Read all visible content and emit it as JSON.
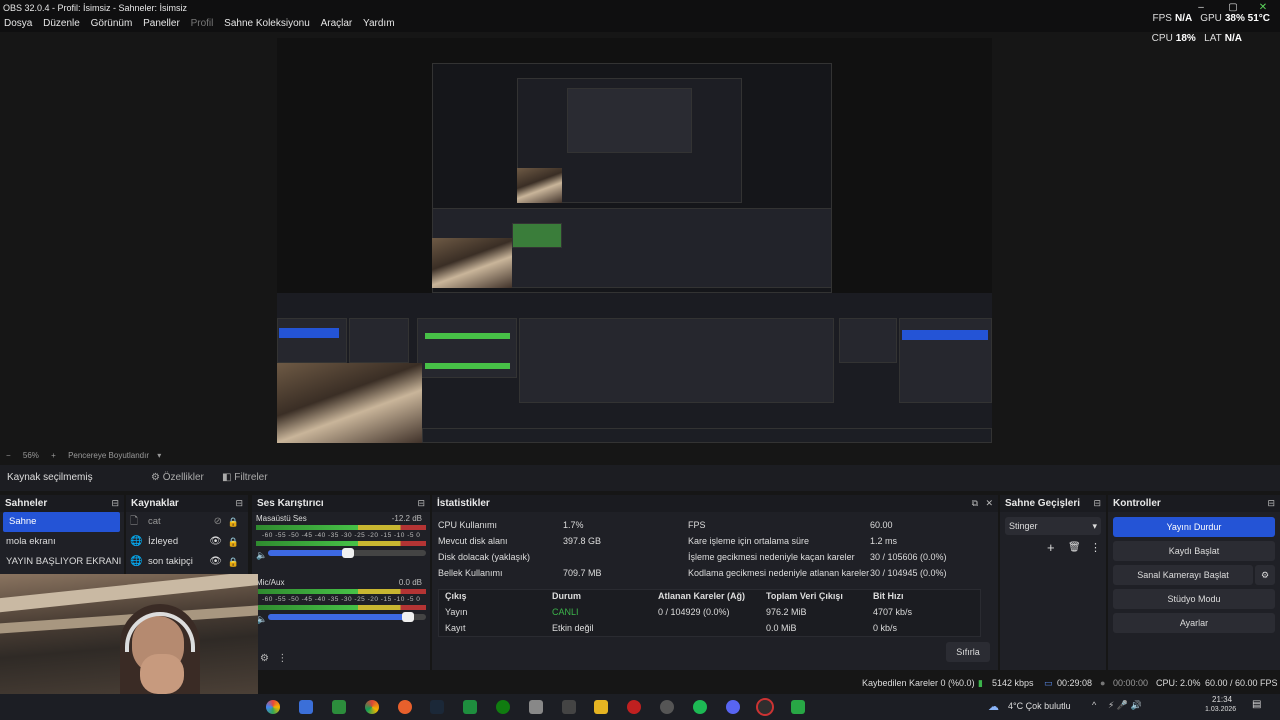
{
  "window": {
    "title": "OBS 32.0.4 - Profil: İsimsiz - Sahneler: İsimsiz"
  },
  "menu": {
    "items": [
      "Dosya",
      "Düzenle",
      "Görünüm",
      "Paneller",
      "Profil",
      "Sahne Koleksiyonu",
      "Araçlar",
      "Yardım"
    ]
  },
  "overlay": {
    "fps_label": "FPS",
    "fps_value": "N/A",
    "gpu_label": "GPU",
    "gpu_value": "38% 51°C",
    "cpu_label": "CPU",
    "cpu_value": "18%",
    "lat_label": "LAT",
    "lat_value": "N/A"
  },
  "zoom": {
    "minus": "−",
    "value": "56%",
    "plus": "+",
    "fit": "Pencereye Boyutlandır"
  },
  "source_bar": {
    "status": "Kaynak seçilmemiş",
    "properties": "Özellikler",
    "filters": "Filtreler"
  },
  "scenes": {
    "title": "Sahneler",
    "items": [
      "Sahne",
      "mola ekranı",
      "YAYIN BAŞLIYOR EKRANI"
    ]
  },
  "sources": {
    "title": "Kaynaklar",
    "items": [
      "cat",
      "İzleyed",
      "son takipçi"
    ]
  },
  "mixer": {
    "title": "Ses Karıştırıcı",
    "scale": "-60 -55 -50 -45 -40 -35 -30 -25 -20 -15 -10 -5 0",
    "channels": [
      {
        "name": "Masaüstü Ses",
        "db": "-12.2 dB",
        "volume": 0.55
      },
      {
        "name": "Mic/Aux",
        "db": "0.0 dB",
        "volume": 1.0
      }
    ]
  },
  "stats": {
    "title": "İstatistikler",
    "left": [
      {
        "label": "CPU Kullanımı",
        "value": "1.7%"
      },
      {
        "label": "Mevcut disk alanı",
        "value": "397.8 GB"
      },
      {
        "label": "Disk dolacak (yaklaşık)",
        "value": ""
      },
      {
        "label": "Bellek Kullanımı",
        "value": "709.7 MB"
      }
    ],
    "right": [
      {
        "label": "FPS",
        "value": "60.00"
      },
      {
        "label": "Kare işleme için ortalama süre",
        "value": "1.2 ms"
      },
      {
        "label": "İşleme gecikmesi nedeniyle kaçan kareler",
        "value": "30 / 105606 (0.0%)"
      },
      {
        "label": "Kodlama gecikmesi nedeniyle atlanan kareler",
        "value": "30 / 104945 (0.0%)"
      }
    ],
    "table": {
      "headers": [
        "Çıkış",
        "Durum",
        "Atlanan Kareler (Ağ)",
        "Toplam Veri Çıkışı",
        "Bit Hızı"
      ],
      "rows": [
        [
          "Yayın",
          "CANLI",
          "0 / 104929 (0.0%)",
          "976.2 MiB",
          "4707 kb/s"
        ],
        [
          "Kayıt",
          "Etkin değil",
          "",
          "0.0 MiB",
          "0 kb/s"
        ]
      ]
    },
    "reset": "Sıfırla"
  },
  "transitions": {
    "title": "Sahne Geçişleri",
    "selected": "Stinger"
  },
  "controls": {
    "title": "Kontroller",
    "buttons": [
      "Yayını Durdur",
      "Kaydı Başlat",
      "Sanal Kamerayı Başlat",
      "Stüdyo Modu",
      "Ayarlar"
    ]
  },
  "statusbar": {
    "dropped": "Kaybedilen Kareler 0 (%0.0)",
    "bitrate": "5142 kbps",
    "live_time": "00:29:08",
    "rec_time": "00:00:00",
    "cpu": "CPU: 2.0%",
    "fps": "60.00 / 60.00 FPS"
  },
  "taskbar": {
    "weather": "4°C Çok bulutlu",
    "time": "21:34",
    "date": "1.03.2026"
  },
  "colors": {
    "accent": "#2454d6",
    "live": "#3cb44b",
    "bg": "#1f2026"
  }
}
